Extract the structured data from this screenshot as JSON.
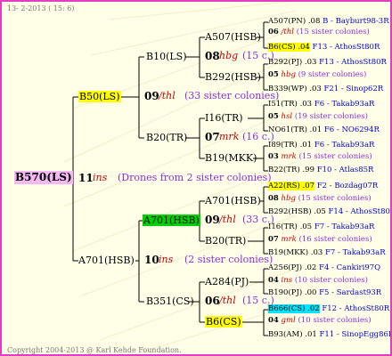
{
  "header": {
    "date": "13- 2-2013 ( 15: 6)"
  },
  "footer": {
    "copyright": "Copyright 2004-2013 @ Karl Kehde Foundation."
  },
  "colors": {
    "border": "#e040c0",
    "line": "#000000",
    "highlight_yellow": "#ffff00",
    "highlight_green": "#00d000",
    "highlight_pink": "#f4b8f4",
    "highlight_cyan": "#00e5ff",
    "breed_red": "#cc0000",
    "sisters_purple": "#8a2be2",
    "links_blue": "#0000cc"
  },
  "root": {
    "label": "B570(LS)",
    "gen": "11",
    "breed": "ins",
    "sisters": "(Drones from 2 sister colonies)"
  },
  "left_upper": {
    "label": "B50(LS)",
    "gen": "09",
    "breed": "/thl",
    "sisters": "(33 sister colonies)"
  },
  "left_lower": {
    "label": "A701(HSB)",
    "gen": "10",
    "breed": "ins",
    "sisters": "(2 sister colonies)"
  },
  "mid": {
    "b10": {
      "label": "B10(LS)",
      "gen": "08",
      "breed": "hbg",
      "sisters": "(15 c.)"
    },
    "b20": {
      "label": "B20(TR)",
      "gen": "07",
      "breed": "mrk",
      "sisters": "(16 c.)"
    },
    "a701": {
      "label": "A701(HSB)",
      "gen": "09",
      "breed": "/thl",
      "sisters": "(33 c.)"
    },
    "b351": {
      "label": "B351(CS)",
      "gen": "06",
      "breed": "/thl",
      "sisters": "(15 c.)"
    }
  },
  "rightmid": {
    "a507": {
      "label": "A507(HSB)"
    },
    "b292": {
      "label": "B292(HSB)"
    },
    "i16": {
      "label": "I16(TR)"
    },
    "b19": {
      "label": "B19(MKK)"
    },
    "a701b": {
      "label": "A701(HSB)"
    },
    "b20b": {
      "label": "B20(TR)"
    },
    "a284": {
      "label": "A284(PJ)"
    },
    "b6": {
      "label": "B6(CS)",
      "gen": "04",
      "breed": "gml",
      "sisters": "(10 sister colonies)"
    }
  },
  "right": [
    {
      "label": "A507(PN) .08",
      "link": "B - Bayburt98-3R"
    },
    {
      "gen": "06",
      "breed": "/thl",
      "sisters": "(15 sister colonies)"
    },
    {
      "label": "B6(CS) .04",
      "link": "F13 - AthosSt80R"
    },
    {
      "label": "B292(PJ) .03",
      "link": "F13 - AthosSt80R"
    },
    {
      "gen": "05",
      "breed": "hbg",
      "sisters": "(9 sister colonies)"
    },
    {
      "label": "B339(WP) .03",
      "link": "F21 - Sinop62R"
    },
    {
      "label": "I51(TR) .03",
      "link": "F6 - Takab93aR"
    },
    {
      "gen": "05",
      "breed": "hsl",
      "sisters": "(19 sister colonies)"
    },
    {
      "label": "NO61(TR) .01",
      "link": "F6 - NO6294R"
    },
    {
      "label": "I89(TR) .01",
      "link": "F6 - Takab93aR"
    },
    {
      "gen": "03",
      "breed": "mrk",
      "sisters": "(15 sister colonies)"
    },
    {
      "label": "B22(TR) .99",
      "link": "F10 - Atlas85R"
    },
    {
      "label": "A22(RS) .07",
      "link": "F2 - Bozdag07R"
    },
    {
      "gen": "08",
      "breed": "hbg",
      "sisters": "(15 sister colonies)"
    },
    {
      "label": "B292(HSB) .05",
      "link": "F14 - AthosSt80R"
    },
    {
      "label": "I16(TR) .05",
      "link": "F7 - Takab93aR"
    },
    {
      "gen": "07",
      "breed": "mrk",
      "sisters": "(16 sister colonies)"
    },
    {
      "label": "B19(MKK) .03",
      "link": "F7 - Takab93aR"
    },
    {
      "label": "A256(PJ) .02",
      "link": "F4 - Cankiri97Q"
    },
    {
      "gen": "04",
      "breed": "ins",
      "sisters": "(10 sister colonies)"
    },
    {
      "label": "B190(PJ) .00",
      "link": "F5 - Sardast93R"
    },
    {
      "label": "B666(CS) .02",
      "link": "F12 - AthosSt80R"
    },
    {
      "gen": "04",
      "breed": "gml",
      "sisters": "(10 sister colonies)"
    },
    {
      "label": "B93(AM) .01",
      "link": "F11 - SinopEgg86R"
    }
  ]
}
